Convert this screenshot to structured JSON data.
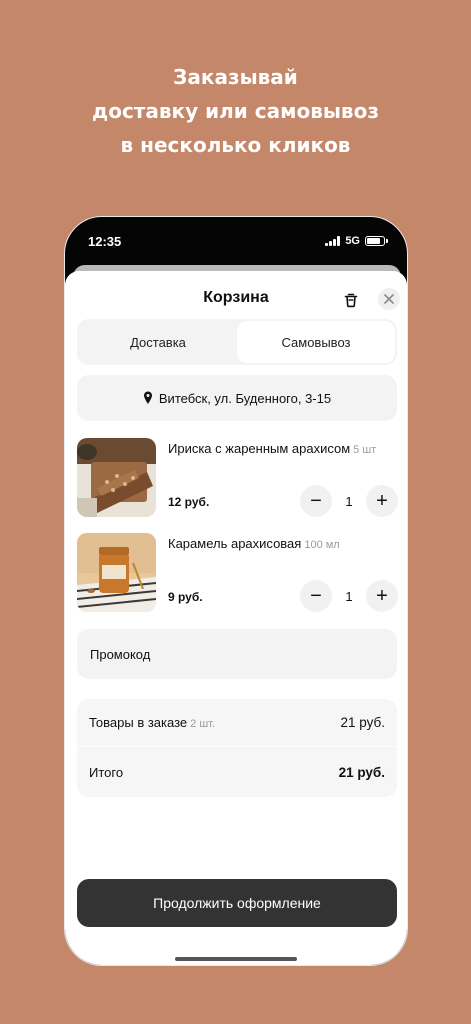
{
  "promo": {
    "line1": "Заказывай",
    "line2": "доставку или самовывоз",
    "line3": "в несколько кликов"
  },
  "status": {
    "time": "12:35",
    "network": "5G"
  },
  "cart": {
    "title": "Корзина",
    "tabs": [
      "Доставка",
      "Самовывоз"
    ],
    "active_tab": "Самовывоз",
    "address": "Витебск, ул. Буденного, 3-15",
    "items": [
      {
        "name": "Ириска с жаренным арахисом",
        "unit": "5 шт",
        "price": "12 руб.",
        "qty": "1"
      },
      {
        "name": "Карамель арахисовая",
        "unit": "100 мл",
        "price": "9 руб.",
        "qty": "1"
      }
    ],
    "promo_label": "Промокод",
    "summary": {
      "goods_label": "Товары в заказе",
      "goods_count": "2 шт.",
      "goods_total": "21 руб.",
      "total_label": "Итого",
      "total_value": "21 руб."
    },
    "continue_label": "Продолжить оформление"
  },
  "icons": {
    "minus": "−",
    "plus": "+",
    "close": "×"
  },
  "colors": {
    "background": "#c4876a",
    "primary_button": "#333333",
    "surface": "#f3f3f3"
  }
}
